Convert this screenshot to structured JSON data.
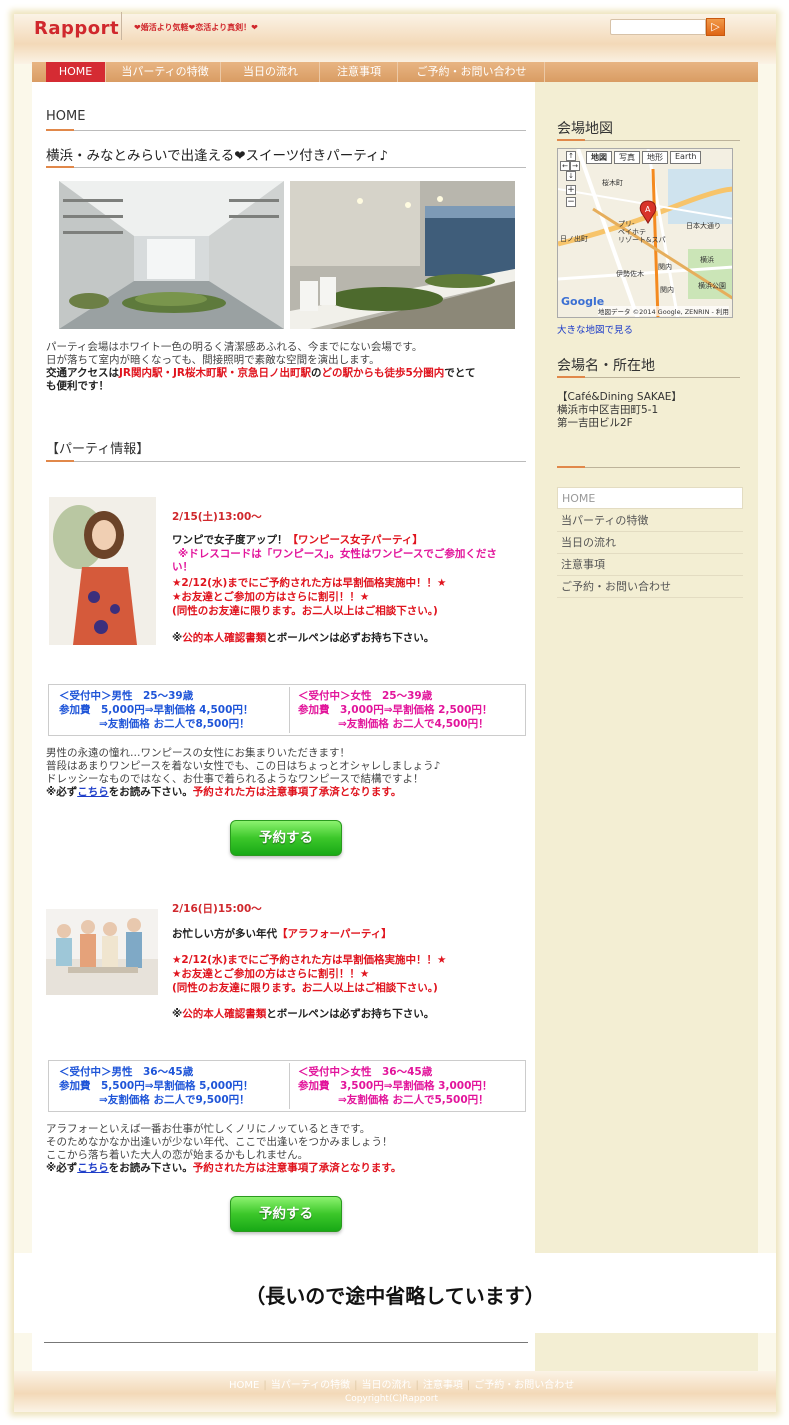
{
  "header": {
    "logo": "Rapport",
    "tagline": "❤婚活より気軽❤恋活より真剣！❤",
    "search_placeholder": "",
    "search_button_icon": "search-icon"
  },
  "nav": {
    "items": [
      {
        "label": "HOME",
        "active": true
      },
      {
        "label": "当パーティの特徴",
        "active": false
      },
      {
        "label": "当日の流れ",
        "active": false
      },
      {
        "label": "注意事項",
        "active": false
      },
      {
        "label": "ご予約・お問い合わせ",
        "active": false
      }
    ]
  },
  "main": {
    "breadcrumb": "HOME",
    "title": "横浜・みなとみらいで出逢える❤スイーツ付きパーティ♪",
    "intro": {
      "line1": "パーティ会場はホワイト一色の明るく清潔感あふれる、今までにない会場です。",
      "line2": "日が落ちて室内が暗くなっても、間接照明で素敵な空間を演出します。",
      "access_prefix": "交通アクセスは",
      "access_stations": "JR関内駅・JR桜木町駅・京急日ノ出町駅",
      "access_mid": "の",
      "access_walk": "どの駅からも徒歩5分圏内",
      "access_suffix1": "でとて",
      "access_suffix2": "も便利です！"
    },
    "section_title": "【パーティ情報】",
    "events": [
      {
        "date": "2/15(土)13:00〜",
        "headline_prefix": "ワンピで女子度アップ！",
        "headline_tag": "【ワンピース女子パーティ】",
        "dresscode_1": "※ドレスコードは「ワンピース」。女性はワンピースでご参加くださ",
        "dresscode_2": "い！",
        "early": "★2/12(水)までにご予約された方は早割価格実施中！！★",
        "friend": "★お友達とご参加の方はさらに割引！！★",
        "friend_note": "(同性のお友達に限ります。お二人以上はご相談下さい。)",
        "id_prefix": "※",
        "id_red": "公的本人確認書類",
        "id_suffix": "とボールペンは必ずお持ち下さい。",
        "male": {
          "status": "＜受付中＞男性　25〜39歳",
          "fee": "参加費　5,000円⇒早割価格 4,500円！",
          "pair": "⇒友割価格 お二人で8,500円！"
        },
        "female": {
          "status": "＜受付中＞女性　25〜39歳",
          "fee": "参加費　3,000円⇒早割価格 2,500円！",
          "pair": "⇒友割価格 お二人で4,500円！"
        },
        "desc1": "男性の永遠の憧れ…ワンピースの女性にお集まりいただきます！",
        "desc2": "普段はあまりワンピースを着ない女性でも、この日はちょっとオシャレしましょう♪",
        "desc3": "ドレッシーなものではなく、お仕事で着られるようなワンピースで結構ですよ！",
        "note_prefix": "※必ず",
        "note_link": "こちら",
        "note_mid": "をお読み下さい。",
        "note_red": "予約された方は注意事項了承済となります。",
        "button": "予約する"
      },
      {
        "date": "2/16(日)15:00〜",
        "headline_prefix": "お忙しい方が多い年代",
        "headline_tag": "【アラフォーパーティ】",
        "early": "★2/12(水)までにご予約された方は早割価格実施中！！★",
        "friend": "★お友達とご参加の方はさらに割引！！★",
        "friend_note": "(同性のお友達に限ります。お二人以上はご相談下さい。)",
        "id_prefix": "※",
        "id_red": "公的本人確認書類",
        "id_suffix": "とボールペンは必ずお持ち下さい。",
        "male": {
          "status": "＜受付中＞男性　36〜45歳",
          "fee": "参加費　5,500円⇒早割価格 5,000円！",
          "pair": "⇒友割価格 お二人で9,500円！"
        },
        "female": {
          "status": "＜受付中＞女性　36〜45歳",
          "fee": "参加費　3,500円⇒早割価格 3,000円！",
          "pair": "⇒友割価格 お二人で5,500円！"
        },
        "desc1": "アラフォーといえば一番お仕事が忙しくノリにノッているときです。",
        "desc2": "そのためなかなか出逢いが少ない年代、ここで出逢いをつかみましょう！",
        "desc3": "ここから落ち着いた大人の恋が始まるかもしれません。",
        "note_prefix": "※必ず",
        "note_link": "こちら",
        "note_mid": "をお読み下さい。",
        "note_red": "予約された方は注意事項了承済となります。",
        "button": "予約する"
      }
    ],
    "omitted": "（長いので途中省略しています）"
  },
  "sidebar": {
    "map_title": "会場地図",
    "map": {
      "buttons": [
        "地図",
        "写真",
        "地形",
        "Earth"
      ],
      "labels": [
        "桜木町",
        "プリ-",
        "ペイホテ",
        "リゾート&スパ",
        "日本大通り",
        "日ノ出町",
        "関内",
        "伊勢佐木",
        "横浜公園",
        "関内",
        "横浜",
        "Google"
      ],
      "attribution": "地図データ ©2014 Google, ZENRIN - 利用"
    },
    "map_link": "大きな地図で見る",
    "venue_title": "会場名・所在地",
    "venue": [
      "【Café&Dining SAKAE】",
      "横浜市中区吉田町5-1",
      "第一吉田ビル2F"
    ],
    "menu": [
      "HOME",
      "当パーティの特徴",
      "当日の流れ",
      "注意事項",
      "ご予約・お問い合わせ"
    ]
  },
  "footer": {
    "links": [
      "HOME",
      "当パーティの特徴",
      "当日の流れ",
      "注意事項",
      "ご予約・お問い合わせ"
    ],
    "copyright": "Copyright(C)Rapport"
  }
}
